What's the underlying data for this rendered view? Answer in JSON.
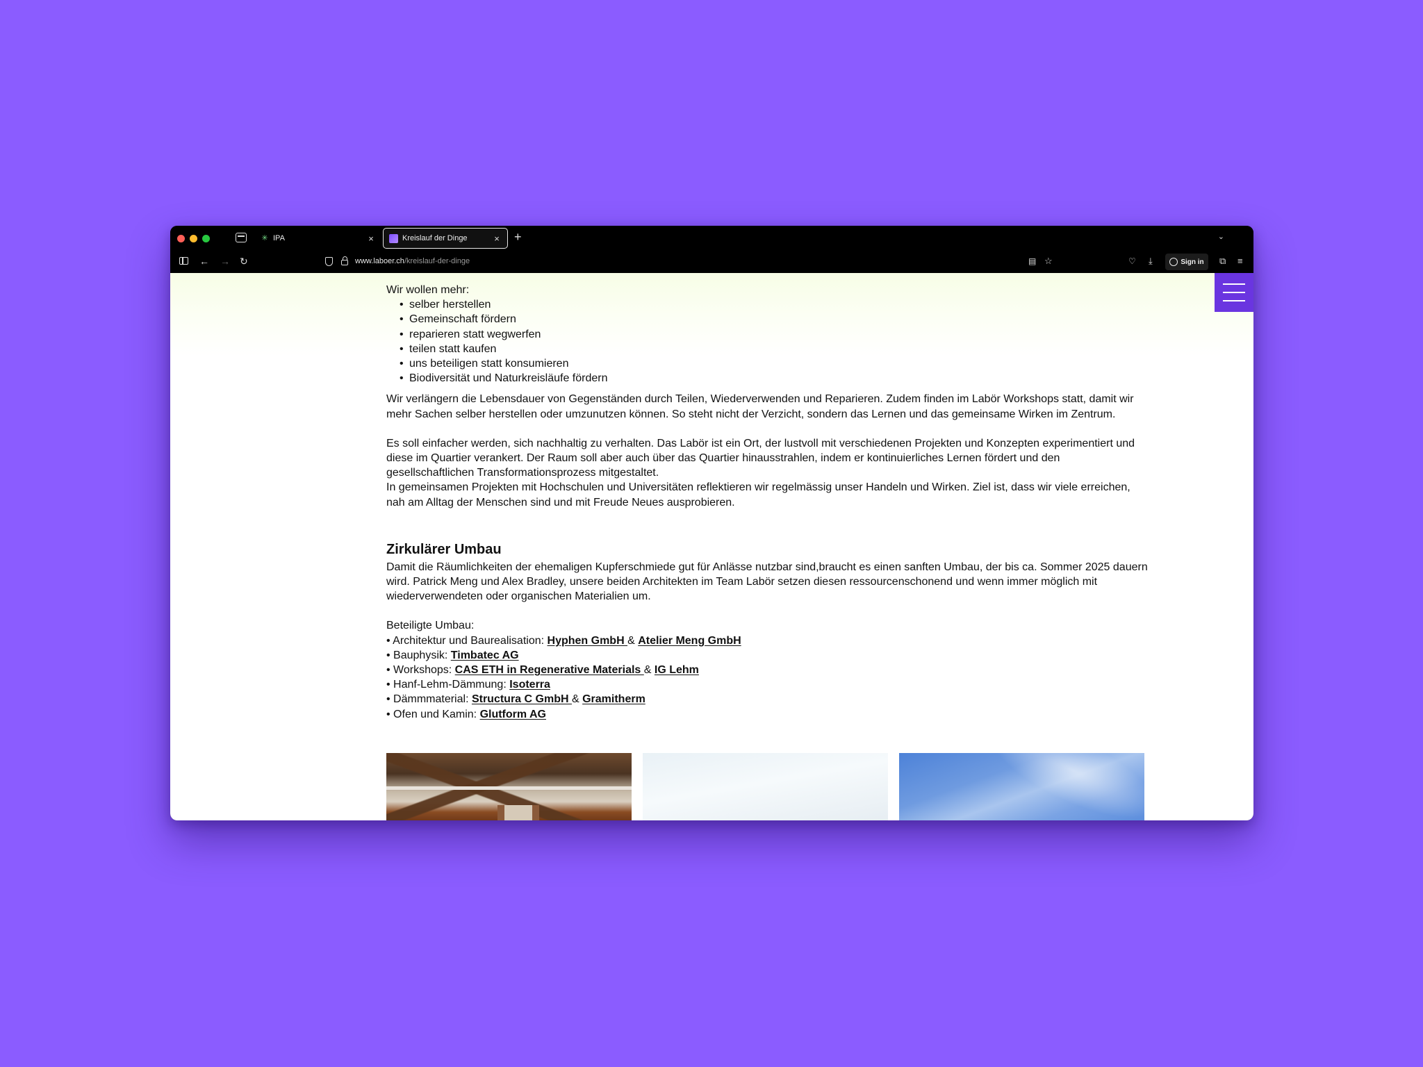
{
  "browser": {
    "tabs": [
      {
        "title": "IPA",
        "active": false
      },
      {
        "title": "Kreislauf der Dinge",
        "active": true
      }
    ],
    "url": {
      "host": "www.laboer.ch",
      "path": "/kreislauf-der-dinge"
    },
    "sign_in_label": "Sign in",
    "colors": {
      "chrome": "#000000",
      "page_background": "#8b5cff"
    }
  },
  "page": {
    "menu_button_color": "#6a35e0",
    "intro_heading": "Wir wollen mehr:",
    "goals": [
      "selber herstellen",
      "Gemeinschaft fördern",
      "reparieren statt wegwerfen",
      "teilen statt kaufen",
      "uns beteiligen statt konsumieren",
      "Biodiversität und Naturkreisläufe fördern"
    ],
    "para1": "Wir verlängern die Lebensdauer von Gegenständen durch Teilen, Wiederverwenden und Reparieren. Zudem finden im Labör Workshops statt, damit wir mehr Sachen selber herstellen oder umzunutzen können. So steht nicht der Verzicht, sondern das Lernen und das gemeinsame Wirken im Zentrum.",
    "para2": "Es soll einfacher werden, sich nachhaltig zu verhalten. Das Labör ist ein Ort, der lustvoll mit verschiedenen Projekten und Konzepten experimentiert und diese im Quartier verankert. Der Raum soll aber auch über das Quartier hinausstrahlen, indem er kontinuierliches Lernen fördert und den gesellschaftlichen Transformationsprozess mitgestaltet.",
    "para3": "In gemeinsamen Projekten mit Hochschulen und Universitäten reflektieren wir regelmässig unser Handeln und Wirken. Ziel ist, dass wir viele erreichen, nah am Alltag der Menschen sind und mit Freude Neues ausprobieren.",
    "section_title": "Zirkulärer Umbau",
    "section_para": "Damit die Räumlichkeiten der ehemaligen Kupferschmiede gut für Anlässe nutzbar sind,braucht es einen sanften Umbau, der bis ca. Sommer 2025 dauern wird. Patrick Meng und Alex Bradley, unsere beiden Architekten im Team Labör setzen diesen ressourcenschonend und wenn immer möglich mit wiederverwendeten oder organischen Materialien um.",
    "participants_heading": "Beteiligte Umbau:",
    "participants": [
      {
        "label": "• Architektur und Baurealisation: ",
        "links": [
          "Hyphen GmbH ",
          "Atelier Meng GmbH"
        ]
      },
      {
        "label": "• Bauphysik: ",
        "links": [
          "Timbatec AG"
        ]
      },
      {
        "label": "• Workshops: ",
        "links": [
          "CAS ETH in Regenerative Materials ",
          "IG Lehm"
        ]
      },
      {
        "label": "• Hanf-Lehm-Dämmung: ",
        "links": [
          "Isoterra"
        ]
      },
      {
        "label": "• Dämmmaterial: ",
        "links": [
          "Structura C GmbH ",
          "Gramitherm"
        ]
      },
      {
        "label": "• Ofen und Kamin: ",
        "links": [
          "Glutform AG"
        ]
      }
    ],
    "link_separator": " & "
  }
}
